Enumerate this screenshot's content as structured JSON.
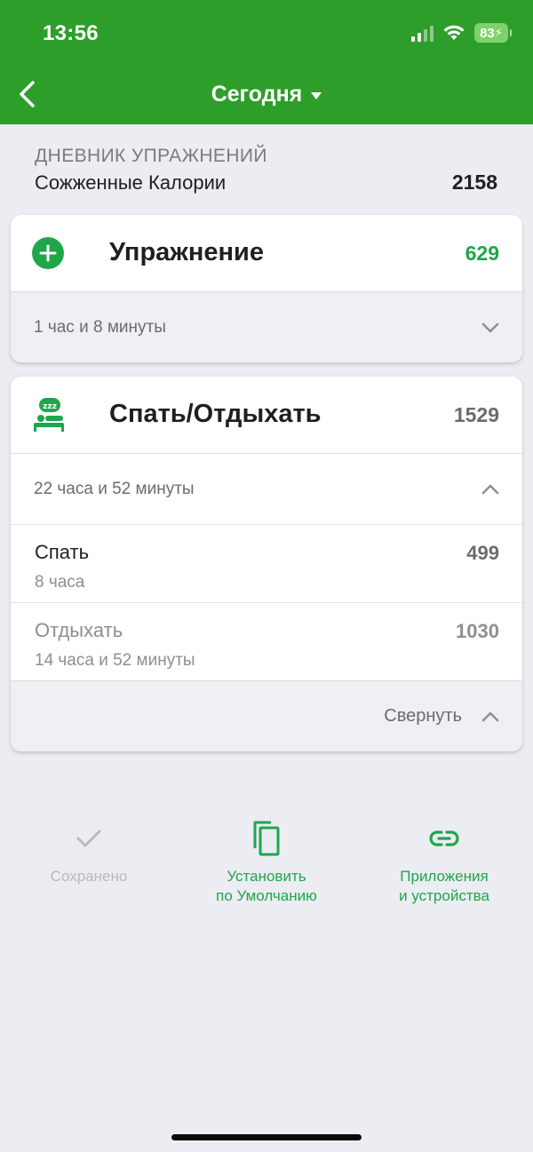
{
  "status_bar": {
    "time": "13:56",
    "battery": "83"
  },
  "nav": {
    "title": "Сегодня"
  },
  "diary": {
    "label": "ДНЕВНИК УПРАЖНЕНИЙ",
    "subtitle": "Сожженные Калории",
    "total": "2158"
  },
  "exercise_card": {
    "title": "Упражнение",
    "value": "629",
    "duration": "1 час и 8 минуты"
  },
  "sleep_card": {
    "title": "Спать/Отдыхать",
    "value": "1529",
    "duration": "22 часа и 52 минуты",
    "items": [
      {
        "name": "Спать",
        "duration": "8 часа",
        "value": "499"
      },
      {
        "name": "Отдыхать",
        "duration": "14 часа и 52 минуты",
        "value": "1030"
      }
    ],
    "collapse_label": "Свернуть"
  },
  "actions": {
    "saved": "Сохранено",
    "set_default_line1": "Установить",
    "set_default_line2": "по Умолчанию",
    "apps_line1": "Приложения",
    "apps_line2": "и устройства"
  },
  "colors": {
    "header_green": "#2E9E2B",
    "accent_green": "#1FA64A",
    "background": "#ECECF3"
  }
}
